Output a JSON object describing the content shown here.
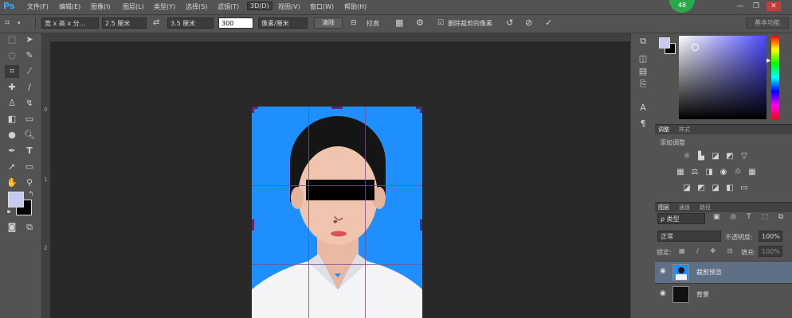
{
  "app": {
    "logo": "Ps"
  },
  "menu": {
    "items": [
      "文件(F)",
      "编辑(E)",
      "图像(I)",
      "图层(L)",
      "类型(Y)",
      "选择(S)",
      "滤镜(T)",
      "3D(D)",
      "视图(V)",
      "窗口(W)",
      "帮助(H)"
    ],
    "active_index": 7
  },
  "badge": {
    "value": "48",
    "color": "#2aa84a"
  },
  "window_controls": {
    "minimize": "—",
    "restore": "❐",
    "close": "✕"
  },
  "options": {
    "ratio_preset": "宽 x 高 x 分...",
    "width_value": "2.5 厘米",
    "swap_icon": "⇄",
    "height_value": "3.5 厘米",
    "resolution_value": "300",
    "unit_select": "像素/厘米",
    "clear_label": "清除",
    "straighten_label": "拉直",
    "delete_pixels_label": "删除裁剪的像素",
    "delete_pixels_checked": true,
    "workspace_label": "基本功能"
  },
  "toolbar": {
    "tools": [
      "move-icon",
      "marquee-icon",
      "lasso-icon",
      "quick-select-icon",
      "crop-icon",
      "eyedropper-icon",
      "healing-icon",
      "brush-icon",
      "stamp-icon",
      "history-brush-icon",
      "eraser-icon",
      "gradient-icon",
      "blur-icon",
      "dodge-icon",
      "pen-icon",
      "type-icon",
      "path-select-icon",
      "shape-icon",
      "hand-icon",
      "zoom-icon"
    ]
  },
  "ruler": {
    "top_marks": [
      "0",
      "1",
      "2"
    ],
    "left_marks": [
      "0",
      "1",
      "2"
    ]
  },
  "colors": {
    "foreground": "#c8c8f0",
    "background": "#000000",
    "accent": "#1f8fff"
  },
  "panels": {
    "adjust_tab": "调整",
    "style_tab": "样式",
    "add_adjustment": "添加调整",
    "layers_tab": "图层",
    "channels_tab": "通道",
    "paths_tab": "路径",
    "filter_kind": "ρ 类型",
    "blend_mode": "正常",
    "opacity_label": "不透明度:",
    "opacity_value": "100%",
    "lock_label": "锁定:",
    "fill_label": "填充:",
    "fill_value": "100%",
    "layers": [
      {
        "name": "裁剪预览",
        "selected": true
      },
      {
        "name": "背景",
        "selected": false
      }
    ]
  }
}
